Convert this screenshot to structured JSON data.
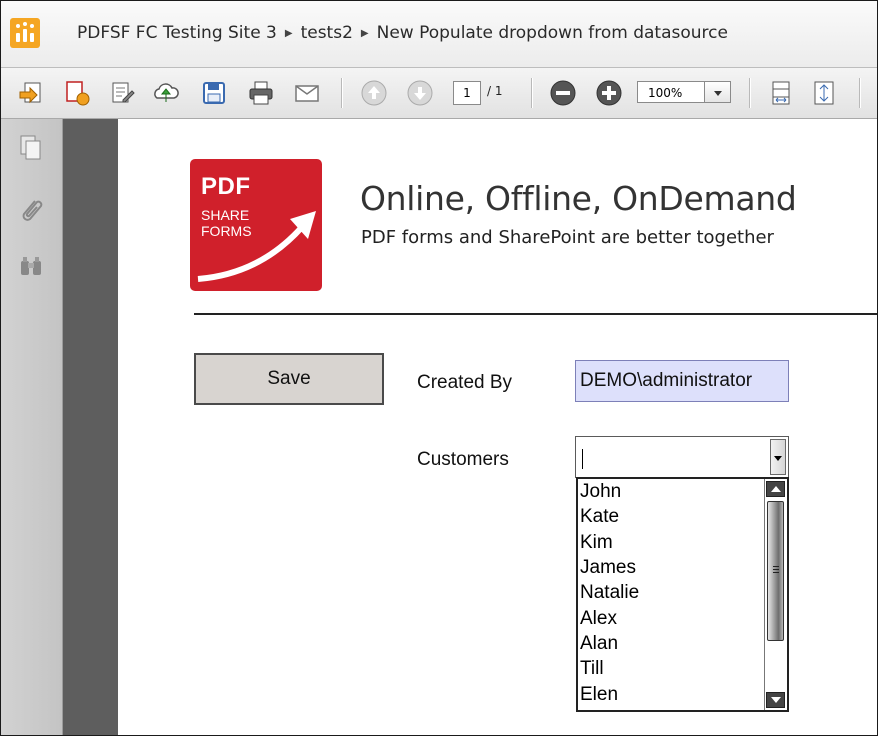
{
  "window": {
    "breadcrumbs": [
      "PDFSF FC Testing Site 3",
      "tests2",
      "New Populate dropdown from datasource"
    ],
    "brand_color": "#f5a623"
  },
  "toolbar": {
    "page_current": "1",
    "page_total": "/ 1",
    "zoom": "100%",
    "icons": [
      "open-file-icon",
      "export-icon",
      "edit-icon",
      "upload-icon",
      "save-disk-icon",
      "print-icon",
      "email-icon",
      "previous-page-icon",
      "next-page-icon",
      "zoom-out-icon",
      "zoom-in-icon",
      "fit-width-icon",
      "fit-page-icon"
    ]
  },
  "rail": {
    "icons": [
      "pages-icon",
      "attachment-icon",
      "find-binoculars-icon"
    ]
  },
  "document": {
    "logo": {
      "line1": "PDF",
      "line2": "SHARE",
      "line3": "FORMS",
      "color": "#d0202b"
    },
    "heading": "Online, Offline, OnDemand",
    "tagline": "PDF forms and SharePoint are better together",
    "save_label": "Save",
    "created_by_label": "Created By",
    "created_by_value": "DEMO\\administrator",
    "customers_label": "Customers",
    "customers_value": "",
    "customer_options": [
      "John",
      "Kate",
      "Kim",
      "James",
      "Natalie",
      "Alex",
      "Alan",
      "Till",
      "Elen"
    ]
  }
}
